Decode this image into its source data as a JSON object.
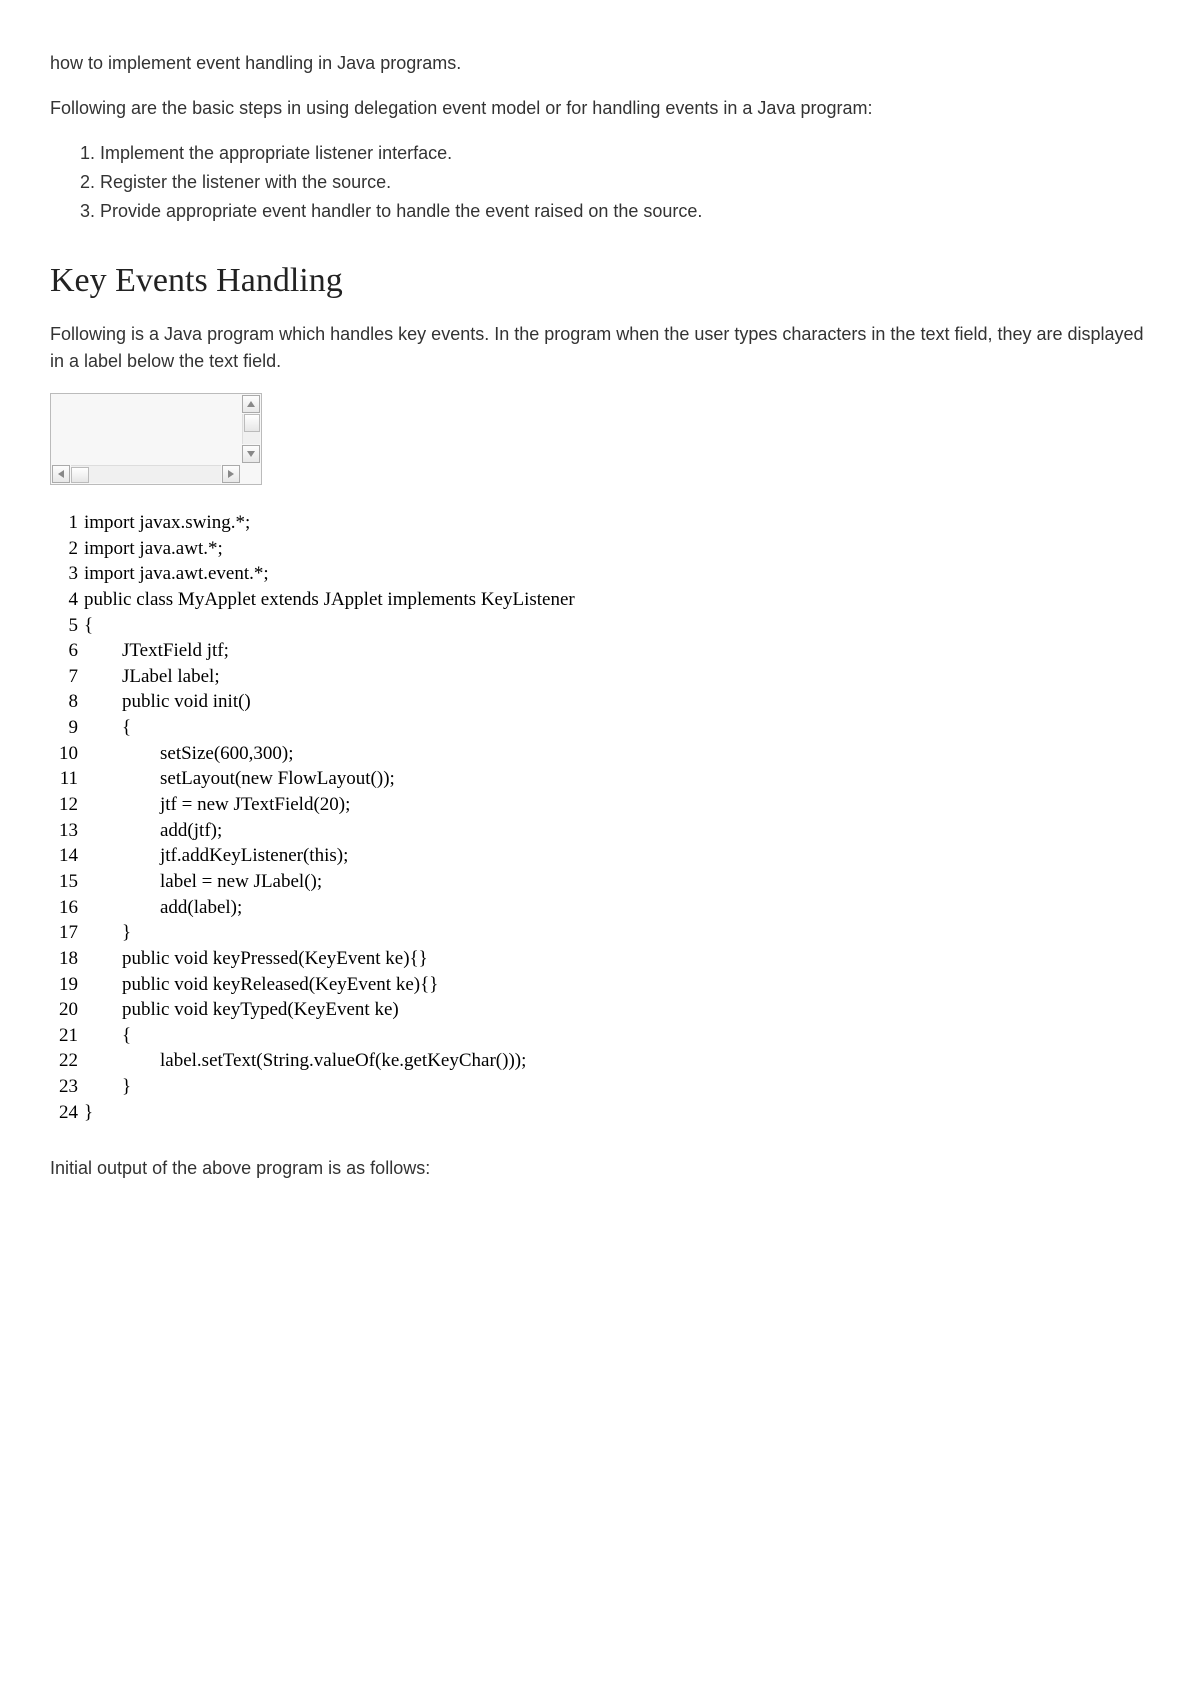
{
  "intro": {
    "p1": "how to implement event handling in Java programs.",
    "p2": " Following are the basic steps in using delegation event model or for handling events in a Java program:",
    "steps": [
      "Implement the appropriate listener interface.",
      "Register the listener with the source.",
      "Provide appropriate event handler to handle the event raised on the source."
    ]
  },
  "section": {
    "heading": "Key Events Handling",
    "desc": " Following is a Java program which handles key events. In the program when the user types characters in the text field, they are displayed in a label below the text field."
  },
  "code": {
    "lines": [
      "import javax.swing.*;",
      "import java.awt.*;",
      "import java.awt.event.*;",
      "public class MyApplet extends JApplet implements KeyListener",
      "{",
      "        JTextField jtf;",
      "        JLabel label;",
      "        public void init()",
      "        {",
      "                setSize(600,300);",
      "                setLayout(new FlowLayout());",
      "                jtf = new JTextField(20);",
      "                add(jtf);",
      "                jtf.addKeyListener(this);",
      "                label = new JLabel();",
      "                add(label);",
      "        }",
      "        public void keyPressed(KeyEvent ke){}",
      "        public void keyReleased(KeyEvent ke){}",
      "        public void keyTyped(KeyEvent ke)",
      "        {",
      "                label.setText(String.valueOf(ke.getKeyChar()));",
      "        }",
      "}"
    ]
  },
  "outro": {
    "p1": "Initial output of the above program is as follows:"
  }
}
